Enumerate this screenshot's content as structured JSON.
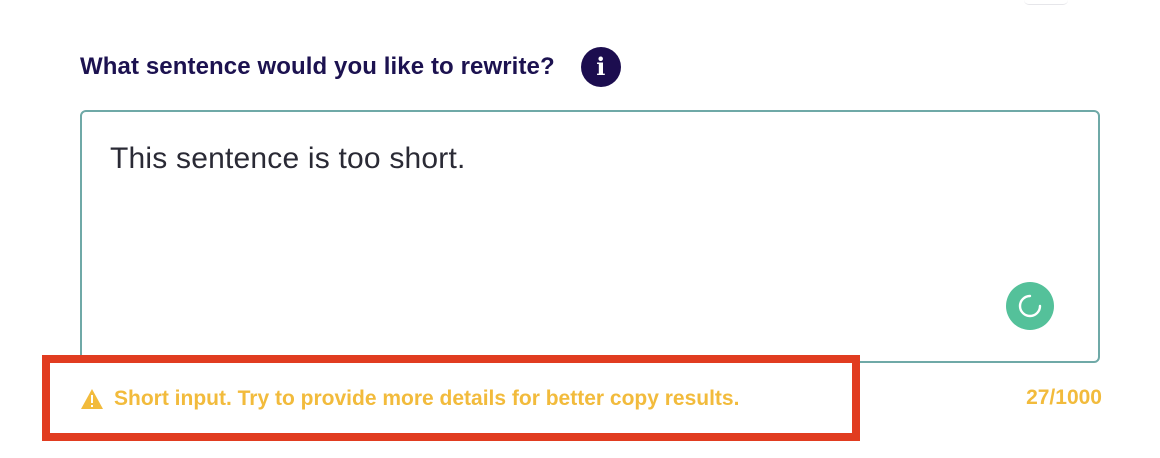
{
  "form": {
    "question_label": "What sentence would you like to rewrite?",
    "info_icon": "info-icon",
    "input_value": "This sentence is too short.",
    "loading_icon": "loading-spinner-icon",
    "warning_icon": "warning-triangle-icon",
    "warning_text": "Short input. Try to provide more details for better copy results.",
    "char_count": "27/1000"
  },
  "colors": {
    "label": "#1c1250",
    "info_icon_bg": "#1c0d4f",
    "textarea_border": "#6fa9a7",
    "spinner_bg": "#54c19a",
    "warning": "#f2bb3c",
    "highlight_border": "#e13c20"
  }
}
